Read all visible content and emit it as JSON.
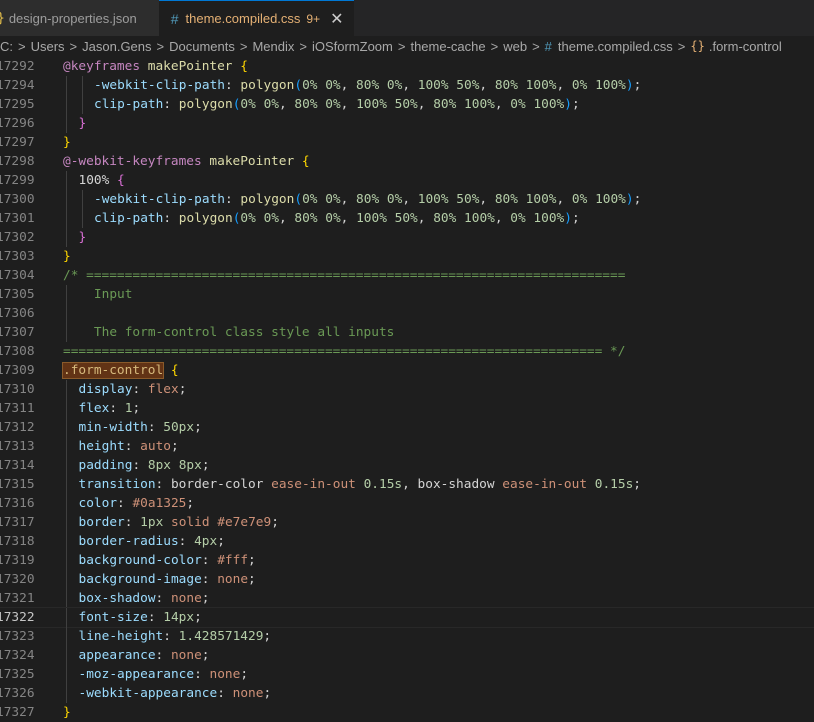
{
  "tabs": [
    {
      "label": "design-properties.json",
      "icon": "json-braces-icon",
      "icon_glyph": "}"
    },
    {
      "label": "theme.compiled.css",
      "icon": "css-hash-icon",
      "icon_glyph": "#",
      "badge": "9+",
      "close_glyph": "✕"
    }
  ],
  "breadcrumb": {
    "items": [
      "C:",
      "Users",
      "Jason.Gens",
      "Documents",
      "Mendix",
      "iOSformZoom",
      "theme-cache",
      "web"
    ],
    "file": "theme.compiled.css",
    "file_icon": "#",
    "symbol": ".form-control",
    "symbol_icon": "{}",
    "separator": ">"
  },
  "editor": {
    "current_line": "17322",
    "lines": [
      {
        "n": "17292",
        "indent": 0,
        "t": [
          [
            "kw",
            "@keyframes"
          ],
          [
            "",
            " "
          ],
          [
            "fn",
            "makePointer"
          ],
          [
            "",
            " "
          ],
          [
            "b1",
            "{"
          ]
        ]
      },
      {
        "n": "17294",
        "indent": 2,
        "t": [
          [
            "prop",
            "-webkit-clip-path"
          ],
          [
            "",
            ": "
          ],
          [
            "fn",
            "polygon"
          ],
          [
            "b3",
            "("
          ],
          [
            "num",
            "0%"
          ],
          [
            "",
            " "
          ],
          [
            "num",
            "0%"
          ],
          [
            "",
            ", "
          ],
          [
            "num",
            "80%"
          ],
          [
            "",
            " "
          ],
          [
            "num",
            "0%"
          ],
          [
            "",
            ", "
          ],
          [
            "num",
            "100%"
          ],
          [
            "",
            " "
          ],
          [
            "num",
            "50%"
          ],
          [
            "",
            ", "
          ],
          [
            "num",
            "80%"
          ],
          [
            "",
            " "
          ],
          [
            "num",
            "100%"
          ],
          [
            "",
            ", "
          ],
          [
            "num",
            "0%"
          ],
          [
            "",
            " "
          ],
          [
            "num",
            "100%"
          ],
          [
            "b3",
            ")"
          ],
          [
            "",
            ";"
          ]
        ]
      },
      {
        "n": "17295",
        "indent": 2,
        "t": [
          [
            "prop",
            "clip-path"
          ],
          [
            "",
            ": "
          ],
          [
            "fn",
            "polygon"
          ],
          [
            "b3",
            "("
          ],
          [
            "num",
            "0%"
          ],
          [
            "",
            " "
          ],
          [
            "num",
            "0%"
          ],
          [
            "",
            ", "
          ],
          [
            "num",
            "80%"
          ],
          [
            "",
            " "
          ],
          [
            "num",
            "0%"
          ],
          [
            "",
            ", "
          ],
          [
            "num",
            "100%"
          ],
          [
            "",
            " "
          ],
          [
            "num",
            "50%"
          ],
          [
            "",
            ", "
          ],
          [
            "num",
            "80%"
          ],
          [
            "",
            " "
          ],
          [
            "num",
            "100%"
          ],
          [
            "",
            ", "
          ],
          [
            "num",
            "0%"
          ],
          [
            "",
            " "
          ],
          [
            "num",
            "100%"
          ],
          [
            "b3",
            ")"
          ],
          [
            "",
            ";"
          ]
        ]
      },
      {
        "n": "17296",
        "indent": 1,
        "t": [
          [
            "b2",
            "}"
          ]
        ]
      },
      {
        "n": "17297",
        "indent": 0,
        "t": [
          [
            "b1",
            "}"
          ]
        ]
      },
      {
        "n": "17298",
        "indent": 0,
        "t": [
          [
            "kw",
            "@-webkit-keyframes"
          ],
          [
            "",
            " "
          ],
          [
            "fn",
            "makePointer"
          ],
          [
            "",
            " "
          ],
          [
            "b1",
            "{"
          ]
        ]
      },
      {
        "n": "17299",
        "indent": 1,
        "t": [
          [
            "",
            "100% "
          ],
          [
            "b2",
            "{"
          ]
        ]
      },
      {
        "n": "17300",
        "indent": 2,
        "t": [
          [
            "prop",
            "-webkit-clip-path"
          ],
          [
            "",
            ": "
          ],
          [
            "fn",
            "polygon"
          ],
          [
            "b3",
            "("
          ],
          [
            "num",
            "0%"
          ],
          [
            "",
            " "
          ],
          [
            "num",
            "0%"
          ],
          [
            "",
            ", "
          ],
          [
            "num",
            "80%"
          ],
          [
            "",
            " "
          ],
          [
            "num",
            "0%"
          ],
          [
            "",
            ", "
          ],
          [
            "num",
            "100%"
          ],
          [
            "",
            " "
          ],
          [
            "num",
            "50%"
          ],
          [
            "",
            ", "
          ],
          [
            "num",
            "80%"
          ],
          [
            "",
            " "
          ],
          [
            "num",
            "100%"
          ],
          [
            "",
            ", "
          ],
          [
            "num",
            "0%"
          ],
          [
            "",
            " "
          ],
          [
            "num",
            "100%"
          ],
          [
            "b3",
            ")"
          ],
          [
            "",
            ";"
          ]
        ]
      },
      {
        "n": "17301",
        "indent": 2,
        "t": [
          [
            "prop",
            "clip-path"
          ],
          [
            "",
            ": "
          ],
          [
            "fn",
            "polygon"
          ],
          [
            "b3",
            "("
          ],
          [
            "num",
            "0%"
          ],
          [
            "",
            " "
          ],
          [
            "num",
            "0%"
          ],
          [
            "",
            ", "
          ],
          [
            "num",
            "80%"
          ],
          [
            "",
            " "
          ],
          [
            "num",
            "0%"
          ],
          [
            "",
            ", "
          ],
          [
            "num",
            "100%"
          ],
          [
            "",
            " "
          ],
          [
            "num",
            "50%"
          ],
          [
            "",
            ", "
          ],
          [
            "num",
            "80%"
          ],
          [
            "",
            " "
          ],
          [
            "num",
            "100%"
          ],
          [
            "",
            ", "
          ],
          [
            "num",
            "0%"
          ],
          [
            "",
            " "
          ],
          [
            "num",
            "100%"
          ],
          [
            "b3",
            ")"
          ],
          [
            "",
            ";"
          ]
        ]
      },
      {
        "n": "17302",
        "indent": 1,
        "t": [
          [
            "b2",
            "}"
          ]
        ]
      },
      {
        "n": "17303",
        "indent": 0,
        "t": [
          [
            "b1",
            "}"
          ]
        ]
      },
      {
        "n": "17304",
        "indent": 0,
        "t": [
          [
            "cmt",
            "/* ======================================================================"
          ]
        ]
      },
      {
        "n": "17305",
        "indent": 1,
        "t": [
          [
            "cmt",
            "  Input"
          ]
        ]
      },
      {
        "n": "17306",
        "indent": 1,
        "t": [
          [
            "",
            ""
          ]
        ]
      },
      {
        "n": "17307",
        "indent": 1,
        "t": [
          [
            "cmt",
            "  The form-control class style all inputs"
          ]
        ]
      },
      {
        "n": "17308",
        "indent": 0,
        "t": [
          [
            "cmt",
            "====================================================================== */"
          ]
        ]
      },
      {
        "n": "17309",
        "indent": 0,
        "t": [
          [
            "sel hl",
            ".form-control"
          ],
          [
            "",
            " "
          ],
          [
            "b1",
            "{"
          ]
        ]
      },
      {
        "n": "17310",
        "indent": 1,
        "t": [
          [
            "prop",
            "display"
          ],
          [
            "",
            ": "
          ],
          [
            "val",
            "flex"
          ],
          [
            "",
            ";"
          ]
        ]
      },
      {
        "n": "17311",
        "indent": 1,
        "t": [
          [
            "prop",
            "flex"
          ],
          [
            "",
            ": "
          ],
          [
            "num",
            "1"
          ],
          [
            "",
            ";"
          ]
        ]
      },
      {
        "n": "17312",
        "indent": 1,
        "t": [
          [
            "prop",
            "min-width"
          ],
          [
            "",
            ": "
          ],
          [
            "num",
            "50px"
          ],
          [
            "",
            ";"
          ]
        ]
      },
      {
        "n": "17313",
        "indent": 1,
        "t": [
          [
            "prop",
            "height"
          ],
          [
            "",
            ": "
          ],
          [
            "val",
            "auto"
          ],
          [
            "",
            ";"
          ]
        ]
      },
      {
        "n": "17314",
        "indent": 1,
        "t": [
          [
            "prop",
            "padding"
          ],
          [
            "",
            ": "
          ],
          [
            "num",
            "8px"
          ],
          [
            "",
            " "
          ],
          [
            "num",
            "8px"
          ],
          [
            "",
            ";"
          ]
        ]
      },
      {
        "n": "17315",
        "indent": 1,
        "t": [
          [
            "prop",
            "transition"
          ],
          [
            "",
            ": border-color "
          ],
          [
            "val",
            "ease-in-out"
          ],
          [
            "",
            " "
          ],
          [
            "num",
            "0.15s"
          ],
          [
            "",
            ", box-shadow "
          ],
          [
            "val",
            "ease-in-out"
          ],
          [
            "",
            " "
          ],
          [
            "num",
            "0.15s"
          ],
          [
            "",
            ";"
          ]
        ]
      },
      {
        "n": "17316",
        "indent": 1,
        "t": [
          [
            "prop",
            "color"
          ],
          [
            "",
            ": "
          ],
          [
            "val",
            "#0a1325"
          ],
          [
            "",
            ";"
          ]
        ]
      },
      {
        "n": "17317",
        "indent": 1,
        "t": [
          [
            "prop",
            "border"
          ],
          [
            "",
            ": "
          ],
          [
            "num",
            "1px"
          ],
          [
            "",
            " "
          ],
          [
            "val",
            "solid"
          ],
          [
            "",
            " "
          ],
          [
            "val",
            "#e7e7e9"
          ],
          [
            "",
            ";"
          ]
        ]
      },
      {
        "n": "17318",
        "indent": 1,
        "t": [
          [
            "prop",
            "border-radius"
          ],
          [
            "",
            ": "
          ],
          [
            "num",
            "4px"
          ],
          [
            "",
            ";"
          ]
        ]
      },
      {
        "n": "17319",
        "indent": 1,
        "t": [
          [
            "prop",
            "background-color"
          ],
          [
            "",
            ": "
          ],
          [
            "val",
            "#fff"
          ],
          [
            "",
            ";"
          ]
        ]
      },
      {
        "n": "17320",
        "indent": 1,
        "t": [
          [
            "prop",
            "background-image"
          ],
          [
            "",
            ": "
          ],
          [
            "val",
            "none"
          ],
          [
            "",
            ";"
          ]
        ]
      },
      {
        "n": "17321",
        "indent": 1,
        "t": [
          [
            "prop",
            "box-shadow"
          ],
          [
            "",
            ": "
          ],
          [
            "val",
            "none"
          ],
          [
            "",
            ";"
          ]
        ]
      },
      {
        "n": "17322",
        "indent": 1,
        "t": [
          [
            "prop",
            "font-size"
          ],
          [
            "",
            ": "
          ],
          [
            "num",
            "14px"
          ],
          [
            "",
            ";"
          ]
        ]
      },
      {
        "n": "17323",
        "indent": 1,
        "t": [
          [
            "prop",
            "line-height"
          ],
          [
            "",
            ": "
          ],
          [
            "num",
            "1.428571429"
          ],
          [
            "",
            ";"
          ]
        ]
      },
      {
        "n": "17324",
        "indent": 1,
        "t": [
          [
            "prop",
            "appearance"
          ],
          [
            "",
            ": "
          ],
          [
            "val",
            "none"
          ],
          [
            "",
            ";"
          ]
        ]
      },
      {
        "n": "17325",
        "indent": 1,
        "t": [
          [
            "prop",
            "-moz-appearance"
          ],
          [
            "",
            ": "
          ],
          [
            "val",
            "none"
          ],
          [
            "",
            ";"
          ]
        ]
      },
      {
        "n": "17326",
        "indent": 1,
        "t": [
          [
            "prop",
            "-webkit-appearance"
          ],
          [
            "",
            ": "
          ],
          [
            "val",
            "none"
          ],
          [
            "",
            ";"
          ]
        ]
      },
      {
        "n": "17327",
        "indent": 0,
        "t": [
          [
            "b1",
            "}"
          ]
        ]
      }
    ]
  },
  "colors": {
    "editor_bg": "#1e1e1e",
    "tab_active_border": "#0078d4",
    "keyword": "#c586c0",
    "function": "#dcdcaa",
    "property": "#9cdcfe",
    "number": "#b5cea8",
    "string_value": "#ce9178",
    "comment": "#6a9955",
    "selector": "#d7ba7d"
  }
}
